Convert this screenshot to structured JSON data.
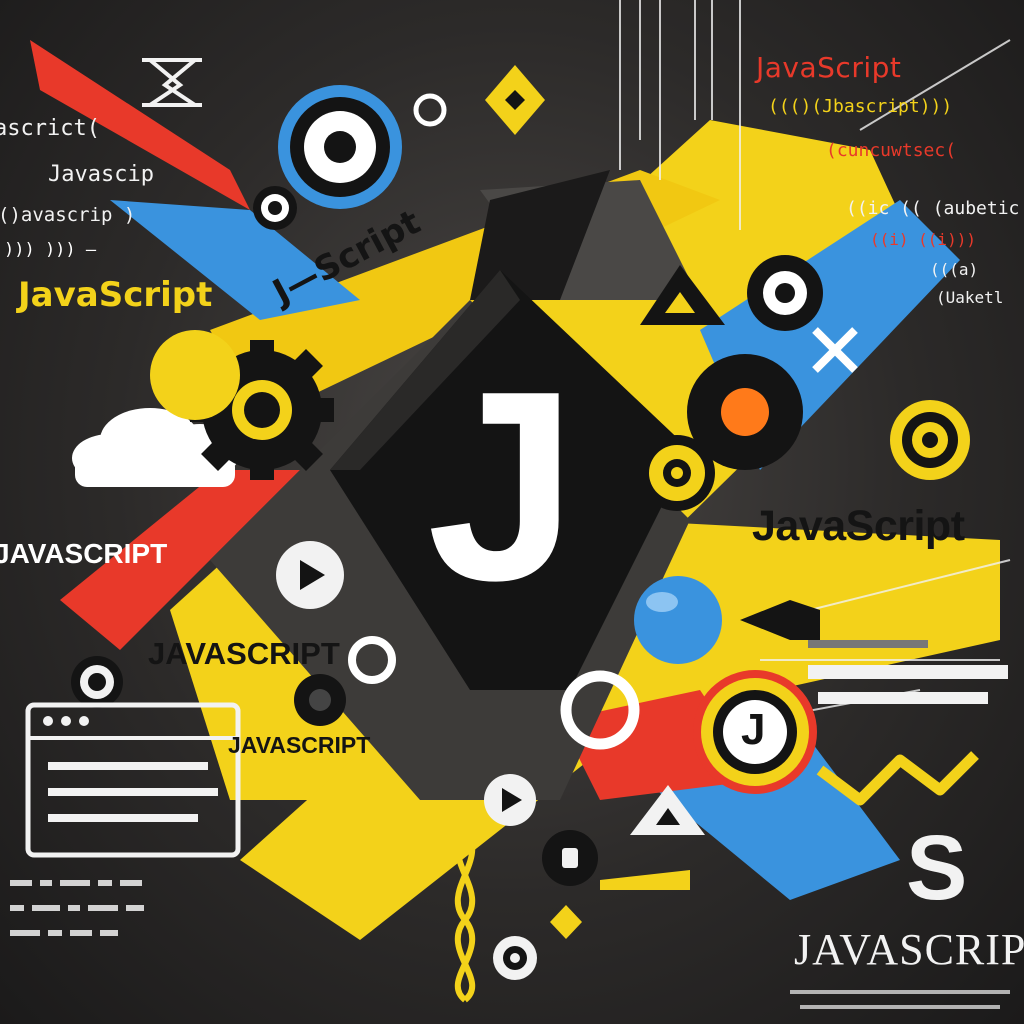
{
  "artwork": {
    "logo_letter": "J",
    "texts": {
      "js_red_top": "JavaScript",
      "js_yellow_left": "JavaScript",
      "js_white_left": "JAVASCRIPT",
      "js_black_right": "JavaScript",
      "js_center": "JAVASCRIPT",
      "js_small": "JAVASCRIPT",
      "js_bottom_right": "JAVASCRIPT",
      "j_script_diag": "J—Script",
      "big_s": "S"
    },
    "code_snippets": {
      "left_1": "ascrict(",
      "left_2": "Javascip",
      "left_3": "()avascrip )",
      "left_4": ")))  ))) —",
      "right_1": "((()(Jbascript)))",
      "right_2": "(cuncuwtsec(",
      "right_3": "((ic ((  (aubetic",
      "right_4": "((i)  ((i)))",
      "right_5": "(((a)",
      "right_6": "(Uaketl"
    }
  },
  "colors": {
    "background": "#2c2a29",
    "yellow": "#f3d21a",
    "red": "#e8392a",
    "blue": "#3a93de",
    "white": "#ffffff",
    "black": "#141414"
  },
  "icons": [
    "gear-icon",
    "cloud-icon",
    "play-icon",
    "triangle-icon",
    "target-icon",
    "browser-window-icon",
    "sphere-icon",
    "diamond-icon",
    "close-icon",
    "wave-icon",
    "helix-icon"
  ]
}
